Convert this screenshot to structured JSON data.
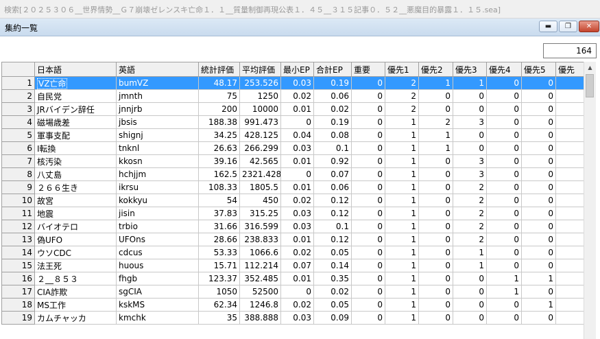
{
  "outer_window": {
    "title": "検索[２０２５３０６__世界情勢__Ｇ７崩壊ゼレンスキ亡命１．１__質量制御再現公表１．４５__３１５記事０．５２__悪魔目的暴露１．１５.sea]"
  },
  "window": {
    "title": "集約一覧",
    "minimize_icon": "minimize-icon",
    "restore_icon": "restore-icon",
    "close_icon": "close-icon"
  },
  "count": "164",
  "table": {
    "headers": [
      "日本語",
      "英語",
      "統計評価",
      "平均評価",
      "最小EP",
      "合計EP",
      "重要",
      "優先1",
      "優先2",
      "優先3",
      "優先4",
      "優先5",
      "優先"
    ],
    "rows": [
      {
        "n": "1",
        "c": [
          "VZ亡命",
          "bumVZ",
          "48.17",
          "253.526",
          "0.03",
          "0.19",
          "0",
          "2",
          "1",
          "1",
          "0",
          "0",
          ""
        ]
      },
      {
        "n": "2",
        "c": [
          "自民党",
          "jmnth",
          "75",
          "1250",
          "0.02",
          "0.06",
          "0",
          "2",
          "0",
          "0",
          "0",
          "0",
          ""
        ]
      },
      {
        "n": "3",
        "c": [
          "JRバイデン辞任",
          "jnnjrb",
          "200",
          "10000",
          "0.01",
          "0.02",
          "0",
          "2",
          "0",
          "0",
          "0",
          "0",
          ""
        ]
      },
      {
        "n": "4",
        "c": [
          "磁場歳差",
          "jbsis",
          "188.38",
          "991.473",
          "0",
          "0.19",
          "0",
          "1",
          "2",
          "3",
          "0",
          "0",
          ""
        ]
      },
      {
        "n": "5",
        "c": [
          "軍事支配",
          "shignj",
          "34.25",
          "428.125",
          "0.04",
          "0.08",
          "0",
          "1",
          "1",
          "0",
          "0",
          "0",
          ""
        ]
      },
      {
        "n": "6",
        "c": [
          "I転換",
          "tnknl",
          "26.63",
          "266.299",
          "0.03",
          "0.1",
          "0",
          "1",
          "1",
          "0",
          "0",
          "0",
          ""
        ]
      },
      {
        "n": "7",
        "c": [
          "核汚染",
          "kkosn",
          "39.16",
          "42.565",
          "0.01",
          "0.92",
          "0",
          "1",
          "0",
          "3",
          "0",
          "0",
          ""
        ]
      },
      {
        "n": "8",
        "c": [
          "八丈島",
          "hchjjm",
          "162.5",
          "2321.428",
          "0",
          "0.07",
          "0",
          "1",
          "0",
          "3",
          "0",
          "0",
          ""
        ]
      },
      {
        "n": "9",
        "c": [
          "２６６生き",
          "ikrsu",
          "108.33",
          "1805.5",
          "0.01",
          "0.06",
          "0",
          "1",
          "0",
          "2",
          "0",
          "0",
          ""
        ]
      },
      {
        "n": "10",
        "c": [
          "故宮",
          "kokkyu",
          "54",
          "450",
          "0.02",
          "0.12",
          "0",
          "1",
          "0",
          "2",
          "0",
          "0",
          ""
        ]
      },
      {
        "n": "11",
        "c": [
          "地震",
          "jisin",
          "37.83",
          "315.25",
          "0.03",
          "0.12",
          "0",
          "1",
          "0",
          "2",
          "0",
          "0",
          ""
        ]
      },
      {
        "n": "12",
        "c": [
          "バイオテロ",
          "trbio",
          "31.66",
          "316.599",
          "0.03",
          "0.1",
          "0",
          "1",
          "0",
          "2",
          "0",
          "0",
          ""
        ]
      },
      {
        "n": "13",
        "c": [
          "偽UFO",
          "UFOns",
          "28.66",
          "238.833",
          "0.01",
          "0.12",
          "0",
          "1",
          "0",
          "2",
          "0",
          "0",
          ""
        ]
      },
      {
        "n": "14",
        "c": [
          "ウソCDC",
          "cdcus",
          "53.33",
          "1066.6",
          "0.02",
          "0.05",
          "0",
          "1",
          "0",
          "1",
          "0",
          "0",
          ""
        ]
      },
      {
        "n": "15",
        "c": [
          "法王死",
          "huous",
          "15.71",
          "112.214",
          "0.07",
          "0.14",
          "0",
          "1",
          "0",
          "1",
          "0",
          "0",
          ""
        ]
      },
      {
        "n": "16",
        "c": [
          "２__８５３",
          "fhgb",
          "123.37",
          "352.485",
          "0.01",
          "0.35",
          "0",
          "1",
          "0",
          "0",
          "1",
          "1",
          ""
        ]
      },
      {
        "n": "17",
        "c": [
          "CIA詐欺",
          "sgCIA",
          "1050",
          "52500",
          "0",
          "0.02",
          "0",
          "1",
          "0",
          "0",
          "1",
          "0",
          ""
        ]
      },
      {
        "n": "18",
        "c": [
          "MS工作",
          "kskMS",
          "62.34",
          "1246.8",
          "0.02",
          "0.05",
          "0",
          "1",
          "0",
          "0",
          "0",
          "1",
          ""
        ]
      },
      {
        "n": "19",
        "c": [
          "カムチャッカ",
          "kmchk",
          "35",
          "388.888",
          "0.03",
          "0.09",
          "0",
          "1",
          "0",
          "0",
          "0",
          "0",
          ""
        ]
      }
    ]
  }
}
